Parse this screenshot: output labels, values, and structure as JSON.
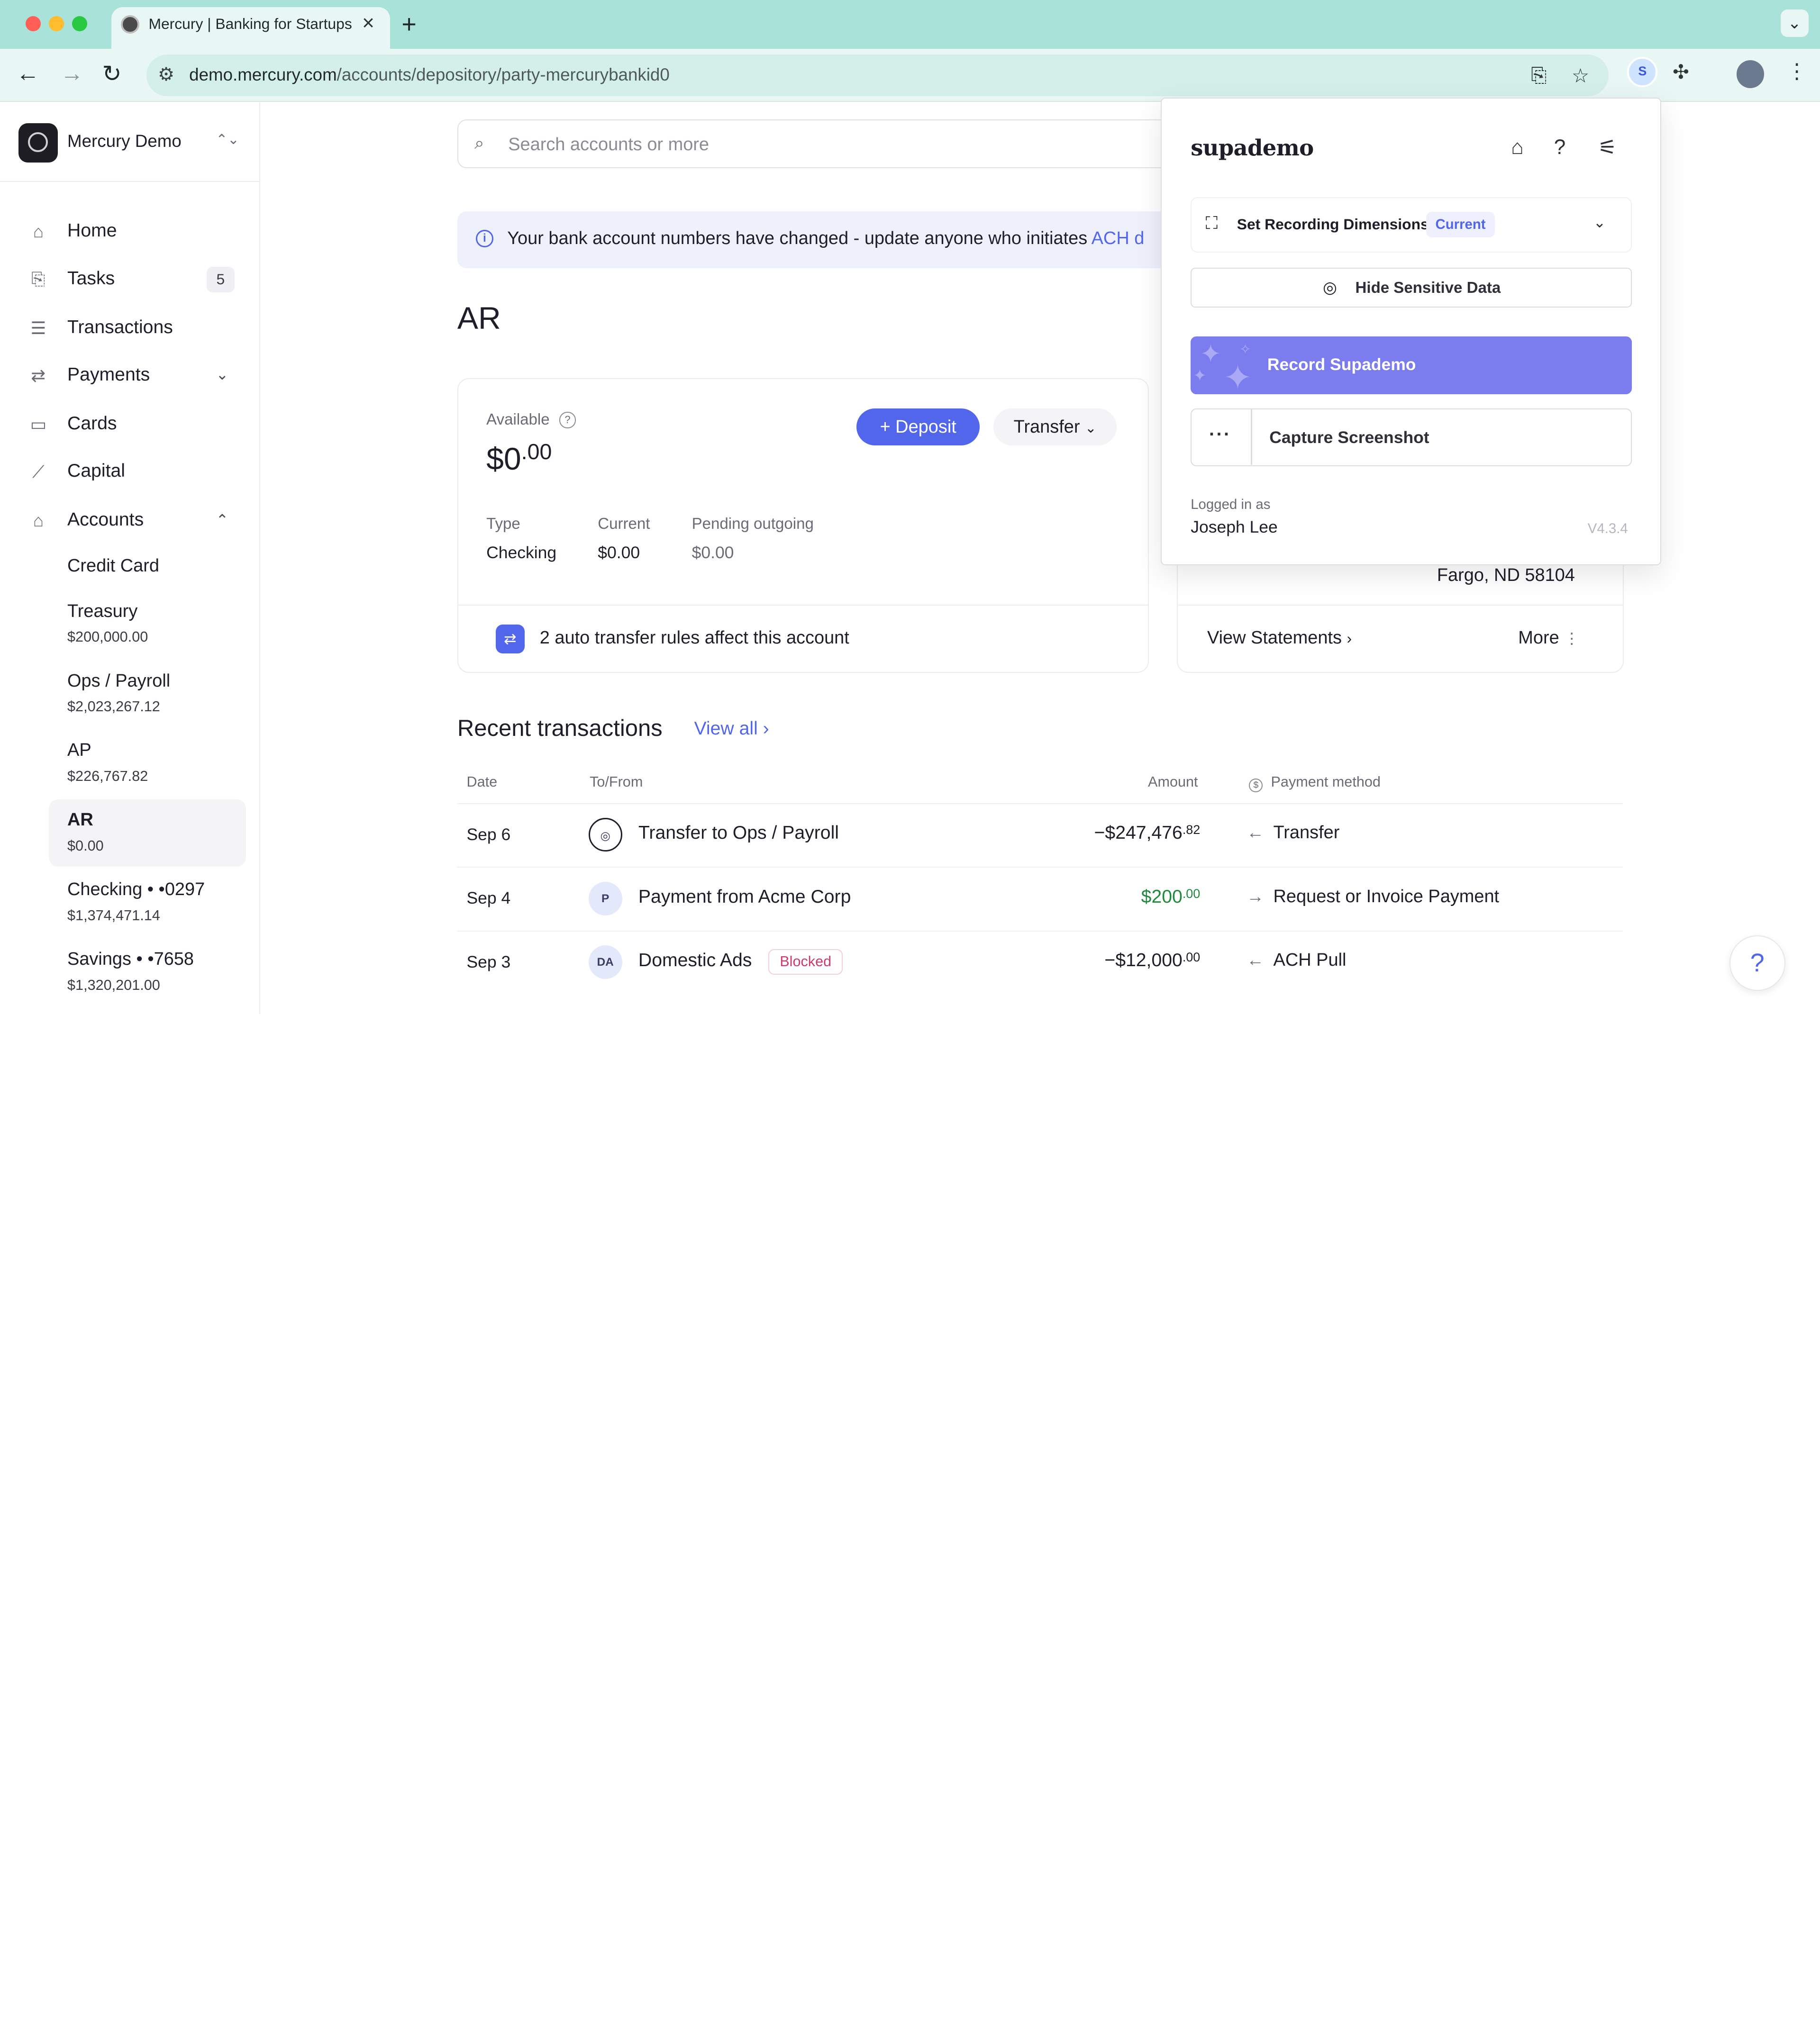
{
  "browser": {
    "tab_title": "Mercury | Banking for Startups",
    "tab_close": "×",
    "new_tab": "+",
    "url_host": "demo.mercury.com",
    "url_path": "/accounts/depository/party-mercurybankid0",
    "extension_badge": "S",
    "colors": {
      "tabbar": "#a9e2d8",
      "toolbar": "#e9f7f4"
    }
  },
  "sidebar": {
    "org_name": "Mercury Demo",
    "nav": [
      {
        "label": "Home",
        "icon": "home-icon"
      },
      {
        "label": "Tasks",
        "icon": "tasks-icon",
        "badge": "5"
      },
      {
        "label": "Transactions",
        "icon": "list-icon"
      },
      {
        "label": "Payments",
        "icon": "arrows-icon"
      },
      {
        "label": "Cards",
        "icon": "card-icon"
      },
      {
        "label": "Capital",
        "icon": "chart-icon"
      },
      {
        "label": "Accounts",
        "icon": "bank-icon"
      }
    ],
    "accounts": [
      {
        "name": "Credit Card",
        "balance": ""
      },
      {
        "name": "Treasury",
        "balance": "$200,000.00"
      },
      {
        "name": "Ops / Payroll",
        "balance": "$2,023,267.12"
      },
      {
        "name": "AP",
        "balance": "$226,767.82"
      },
      {
        "name": "AR",
        "balance": "$0.00"
      },
      {
        "name": "Checking • •0297",
        "balance": "$1,374,471.14"
      },
      {
        "name": "Savings • •7658",
        "balance": "$1,320,201.00"
      }
    ]
  },
  "main": {
    "search_placeholder": "Search accounts or more",
    "banner_text": "Your bank account numbers have changed - update anyone who initiates ",
    "banner_link": "ACH d",
    "title": "AR",
    "available_label": "Available",
    "available_main": "$0",
    "available_cents": ".00",
    "deposit_label": "+ Deposit",
    "transfer_label": "Transfer",
    "type_label": "Type",
    "type_value": "Checking",
    "current_label": "Current",
    "current_value": "$0.00",
    "pending_label": "Pending outgoing",
    "pending_value": "$0.00",
    "auto_rules_text": "2 auto transfer rules affect this account",
    "address_line": "Fargo, ND 58104",
    "view_statements": "View Statements",
    "more": "More",
    "recent_title": "Recent transactions",
    "view_all": "View all",
    "columns": {
      "date": "Date",
      "to_from": "To/From",
      "amount": "Amount",
      "method": "Payment method"
    },
    "transactions": [
      {
        "date": "Sep 6",
        "avatar": "",
        "name": "Transfer to Ops / Payroll",
        "amount_main": "−$247,476",
        "amount_cents": ".82",
        "direction": "←",
        "method": "Transfer",
        "tag": ""
      },
      {
        "date": "Sep 4",
        "avatar": "P",
        "name": "Payment from Acme Corp",
        "amount_main": "$200",
        "amount_cents": ".00",
        "direction": "→",
        "method": "Request or Invoice Payment",
        "tag": ""
      },
      {
        "date": "Sep 3",
        "avatar": "DA",
        "name": "Domestic Ads",
        "amount_main": "−$12,000",
        "amount_cents": ".00",
        "direction": "←",
        "method": "ACH Pull",
        "tag": "Blocked"
      }
    ],
    "help_fab": "?",
    "colors": {
      "accent": "#5266eb",
      "positive": "#1f8a3c",
      "blocked": "#d03a6a"
    }
  },
  "supademo": {
    "logo": "supademo",
    "dimensions_label": "Set Recording Dimensions",
    "dimensions_badge": "Current",
    "hide_label": "Hide Sensitive Data",
    "record_label": "Record Supademo",
    "capture_label": "Capture Screenshot",
    "logged_in_label": "Logged in as",
    "user": "Joseph Lee",
    "version": "V4.3.4",
    "colors": {
      "record": "#7b7cee"
    }
  }
}
